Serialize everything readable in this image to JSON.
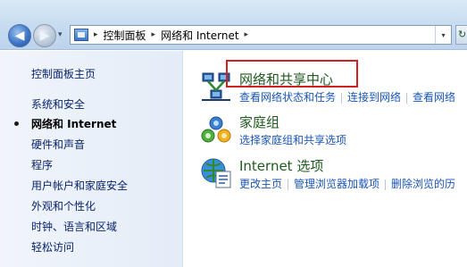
{
  "window": {
    "address_segments": [
      "控制面板",
      "网络和 Internet"
    ],
    "separator_glyph": "▸",
    "dropdown_glyph": "▾",
    "back_glyph": "◀",
    "forward_glyph": "▶",
    "refresh_glyph": "↻"
  },
  "sidebar": {
    "home": "控制面板主页",
    "items": [
      {
        "label": "系统和安全",
        "active": false
      },
      {
        "label": "网络和 Internet",
        "active": true
      },
      {
        "label": "硬件和声音",
        "active": false
      },
      {
        "label": "程序",
        "active": false
      },
      {
        "label": "用户帐户和家庭安全",
        "active": false
      },
      {
        "label": "外观和个性化",
        "active": false
      },
      {
        "label": "时钟、语言和区域",
        "active": false
      },
      {
        "label": "轻松访问",
        "active": false
      }
    ]
  },
  "categories": [
    {
      "title": "网络和共享中心",
      "icon": "network-sharing-icon",
      "links": [
        "查看网络状态和任务",
        "连接到网络",
        "查看网络"
      ],
      "highlighted": true
    },
    {
      "title": "家庭组",
      "icon": "homegroup-icon",
      "links": [
        "选择家庭组和共享选项"
      ]
    },
    {
      "title": "Internet 选项",
      "icon": "internet-options-icon",
      "links": [
        "更改主页",
        "管理浏览器加载项",
        "删除浏览的历"
      ]
    }
  ],
  "colors": {
    "highlight_border": "#d22020",
    "link": "#1a56b4",
    "category_title": "#1e5a1e"
  }
}
